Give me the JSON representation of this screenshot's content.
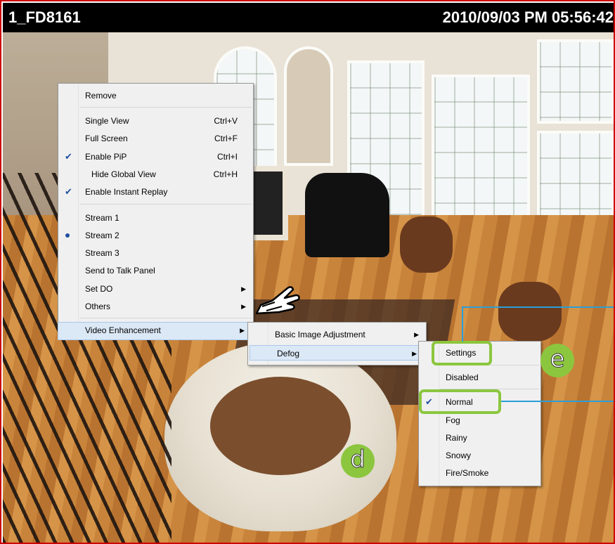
{
  "titlebar": {
    "camera": "1_FD8161",
    "timestamp": "2010/09/03 PM 05:56:42"
  },
  "context_menu": {
    "items": [
      {
        "label": "Remove"
      },
      {
        "label": "Single View",
        "shortcut": "Ctrl+V"
      },
      {
        "label": "Full Screen",
        "shortcut": "Ctrl+F"
      },
      {
        "label": "Enable PiP",
        "shortcut": "Ctrl+I",
        "checked": true
      },
      {
        "label": "Hide Global View",
        "shortcut": "Ctrl+H"
      },
      {
        "label": "Enable Instant Replay",
        "checked": true
      },
      {
        "label": "Stream 1"
      },
      {
        "label": "Stream 2",
        "selected": true
      },
      {
        "label": "Stream 3"
      },
      {
        "label": "Send to Talk Panel"
      },
      {
        "label": "Set DO"
      },
      {
        "label": "Others"
      },
      {
        "label": "Video Enhancement"
      }
    ]
  },
  "submenu_video_enhancement": {
    "items": [
      {
        "label": "Basic Image Adjustment"
      },
      {
        "label": "Defog"
      }
    ]
  },
  "submenu_defog": {
    "items": [
      {
        "label": "Settings"
      },
      {
        "label": "Disabled"
      },
      {
        "label": "Normal",
        "checked": true
      },
      {
        "label": "Fog"
      },
      {
        "label": "Rainy"
      },
      {
        "label": "Snowy"
      },
      {
        "label": "Fire/Smoke"
      }
    ]
  },
  "annotations": {
    "badge_d": "d",
    "badge_e": "e"
  },
  "colors": {
    "frame_border": "#cc0000",
    "callout_green": "#8cc63f",
    "callout_line": "#2a9fd8",
    "menu_bg": "#f0f0f0"
  }
}
